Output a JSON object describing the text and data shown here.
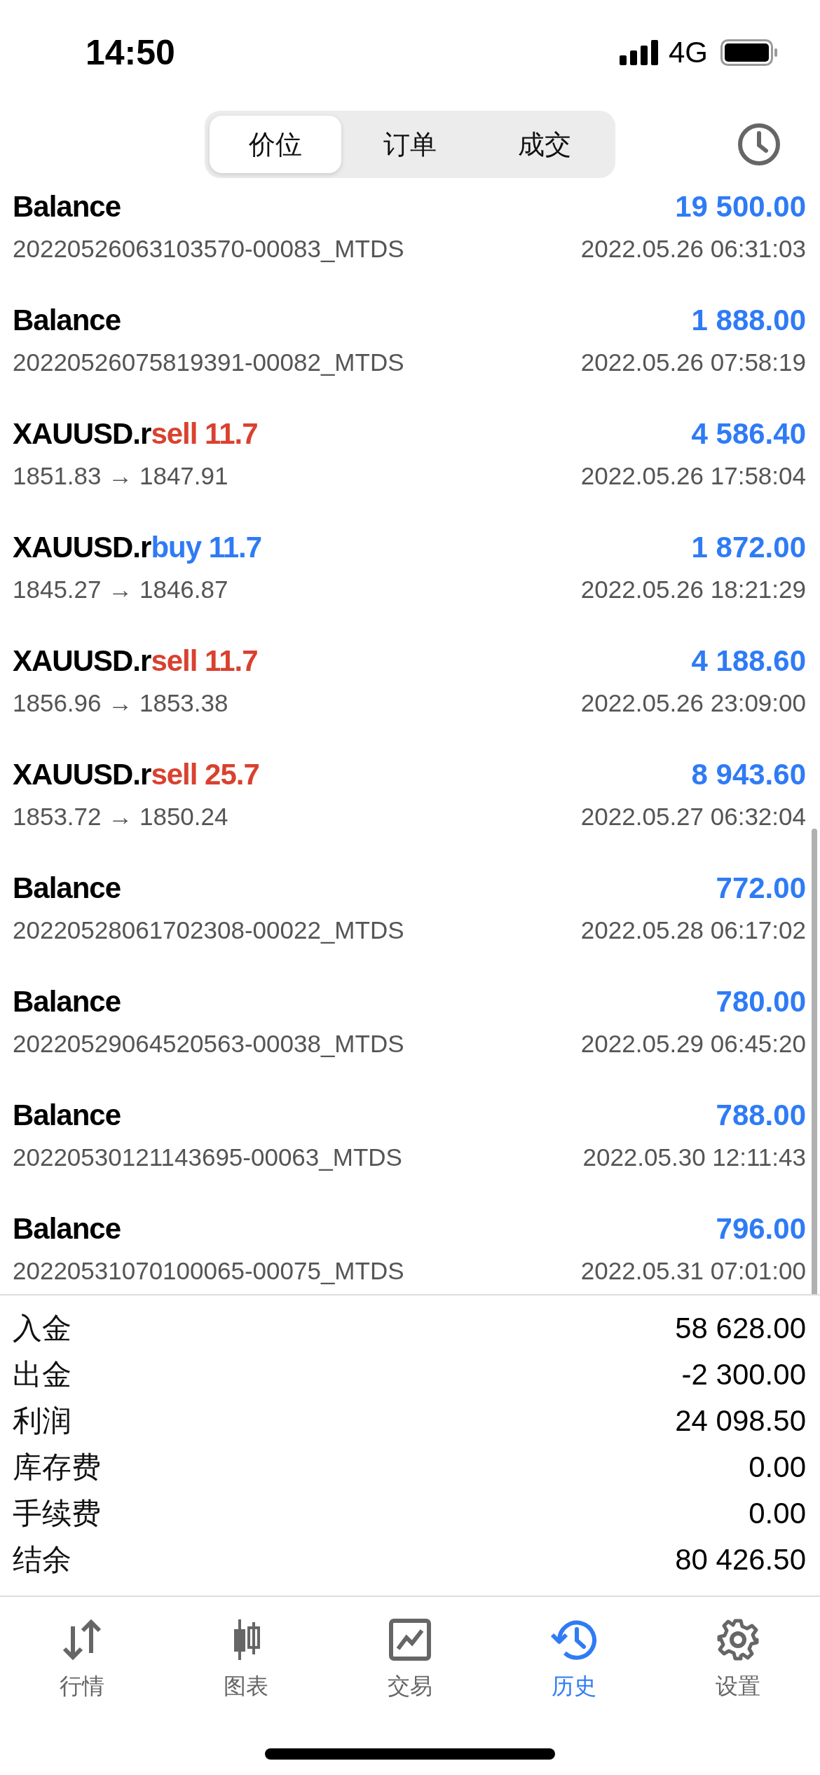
{
  "status_bar": {
    "time": "14:50",
    "network": "4G"
  },
  "segments": [
    {
      "label": "价位",
      "selected": true
    },
    {
      "label": "订单",
      "selected": false
    },
    {
      "label": "成交",
      "selected": false
    }
  ],
  "deals": [
    {
      "kind": "balance",
      "title": "Balance",
      "detail": "20220526063103570-00083_MTDS",
      "amount": "19 500.00",
      "time": "2022.05.26 06:31:03"
    },
    {
      "kind": "balance",
      "title": "Balance",
      "detail": "20220526075819391-00082_MTDS",
      "amount": "1 888.00",
      "time": "2022.05.26 07:58:19"
    },
    {
      "kind": "trade",
      "title": "XAUUSD.r",
      "action": "sell 11.7",
      "color": "#d9412f",
      "detail": "1851.83 → 1847.91",
      "amount": "4 586.40",
      "time": "2022.05.26 17:58:04"
    },
    {
      "kind": "trade",
      "title": "XAUUSD.r",
      "action": "buy 11.7",
      "color": "#2f7bf5",
      "detail": "1845.27 → 1846.87",
      "amount": "1 872.00",
      "time": "2022.05.26 18:21:29"
    },
    {
      "kind": "trade",
      "title": "XAUUSD.r",
      "action": "sell 11.7",
      "color": "#d9412f",
      "detail": "1856.96 → 1853.38",
      "amount": "4 188.60",
      "time": "2022.05.26 23:09:00"
    },
    {
      "kind": "trade",
      "title": "XAUUSD.r",
      "action": "sell 25.7",
      "color": "#d9412f",
      "detail": "1853.72 → 1850.24",
      "amount": "8 943.60",
      "time": "2022.05.27 06:32:04"
    },
    {
      "kind": "balance",
      "title": "Balance",
      "detail": "20220528061702308-00022_MTDS",
      "amount": "772.00",
      "time": "2022.05.28 06:17:02"
    },
    {
      "kind": "balance",
      "title": "Balance",
      "detail": "20220529064520563-00038_MTDS",
      "amount": "780.00",
      "time": "2022.05.29 06:45:20"
    },
    {
      "kind": "balance",
      "title": "Balance",
      "detail": "20220530121143695-00063_MTDS",
      "amount": "788.00",
      "time": "2022.05.30 12:11:43"
    },
    {
      "kind": "balance",
      "title": "Balance",
      "detail": "20220531070100065-00075_MTDS",
      "amount": "796.00",
      "time": "2022.05.31 07:01:00"
    }
  ],
  "summary": [
    {
      "label": "入金",
      "value": "58 628.00"
    },
    {
      "label": "出金",
      "value": "-2 300.00"
    },
    {
      "label": "利润",
      "value": "24 098.50"
    },
    {
      "label": "库存费",
      "value": "0.00"
    },
    {
      "label": "手续费",
      "value": "0.00"
    },
    {
      "label": "结余",
      "value": "80 426.50"
    }
  ],
  "tab_bar": [
    {
      "kind": "quotes",
      "label": "行情",
      "selected": false
    },
    {
      "kind": "chart",
      "label": "图表",
      "selected": false
    },
    {
      "kind": "trade",
      "label": "交易",
      "selected": false
    },
    {
      "kind": "history",
      "label": "历史",
      "selected": true
    },
    {
      "kind": "settings",
      "label": "设置",
      "selected": false
    }
  ]
}
